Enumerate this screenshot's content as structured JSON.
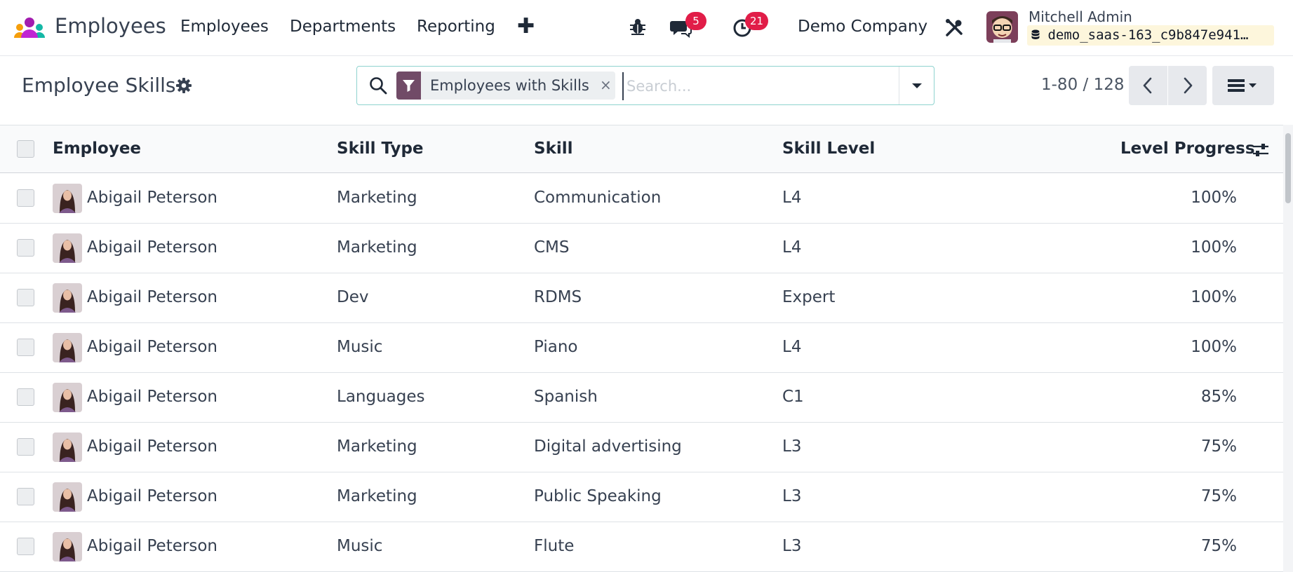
{
  "navbar": {
    "app_name": "Employees",
    "menu": [
      "Employees",
      "Departments",
      "Reporting"
    ],
    "plus_label": "✚",
    "messages_count": "5",
    "activities_count": "21",
    "company": "Demo Company",
    "user_name": "Mitchell Admin",
    "database": "demo_saas-163_c9b847e941…",
    "colors": {
      "badge": "#e11d48",
      "brand": "#714b67"
    }
  },
  "control_panel": {
    "title": "Employee Skills",
    "facet_label": "Employees with Skills",
    "facet_close": "×",
    "search_placeholder": "Search...",
    "pager_value": "1-80 / 128"
  },
  "table": {
    "columns": [
      "Employee",
      "Skill Type",
      "Skill",
      "Skill Level",
      "Level Progress"
    ],
    "rows": [
      {
        "employee": "Abigail Peterson",
        "skill_type": "Marketing",
        "skill": "Communication",
        "level": "L4",
        "progress": "100%"
      },
      {
        "employee": "Abigail Peterson",
        "skill_type": "Marketing",
        "skill": "CMS",
        "level": "L4",
        "progress": "100%"
      },
      {
        "employee": "Abigail Peterson",
        "skill_type": "Dev",
        "skill": "RDMS",
        "level": "Expert",
        "progress": "100%"
      },
      {
        "employee": "Abigail Peterson",
        "skill_type": "Music",
        "skill": "Piano",
        "level": "L4",
        "progress": "100%"
      },
      {
        "employee": "Abigail Peterson",
        "skill_type": "Languages",
        "skill": "Spanish",
        "level": "C1",
        "progress": "85%"
      },
      {
        "employee": "Abigail Peterson",
        "skill_type": "Marketing",
        "skill": "Digital advertising",
        "level": "L3",
        "progress": "75%"
      },
      {
        "employee": "Abigail Peterson",
        "skill_type": "Marketing",
        "skill": "Public Speaking",
        "level": "L3",
        "progress": "75%"
      },
      {
        "employee": "Abigail Peterson",
        "skill_type": "Music",
        "skill": "Flute",
        "level": "L3",
        "progress": "75%"
      }
    ]
  }
}
